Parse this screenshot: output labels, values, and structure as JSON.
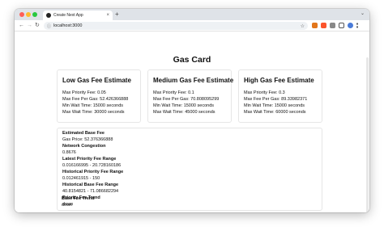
{
  "browser": {
    "tab_title": "Create Next App",
    "tab_close": "×",
    "new_tab": "+",
    "tab_menu": "⌄",
    "back": "←",
    "forward": "→",
    "reload": "↻",
    "url": "localhost:3000",
    "url_info": "ⓘ",
    "bookmark": "☆",
    "colors": {
      "close": "#ff5f57",
      "minimize": "#febc2e",
      "maximize": "#28c840",
      "tabbar": "#dfe3e8"
    },
    "extensions": [
      {
        "name": "fox-extension-icon",
        "color": "#e2761b"
      },
      {
        "name": "shield-extension-icon",
        "color": "#fb542b"
      },
      {
        "name": "puzzle-extension-icon",
        "color": "#666666"
      },
      {
        "name": "sidebar-icon",
        "color": "#555555"
      },
      {
        "name": "profile-icon",
        "color": "#4a7bd8"
      },
      {
        "name": "menu-icon",
        "color": "#555555"
      }
    ]
  },
  "page": {
    "title": "Gas Card",
    "cards": [
      {
        "title": "Low Gas Fee Estimate",
        "priority": "Max Priority Fee: 0.05",
        "fee_per_gas": "Max Fee Per Gas: 52.426366888",
        "min_wait": "Min Wait Time: 15000 seconds",
        "max_wait": "Max Wait Time: 30000 seconds"
      },
      {
        "title": "Medium Gas Fee Estimate",
        "priority": "Max Priority Fee: 0.1",
        "fee_per_gas": "Max Fee Per Gas: 70.808095299",
        "min_wait": "Min Wait Time: 15000 seconds",
        "max_wait": "Max Wait Time: 45000 seconds"
      },
      {
        "title": "High Gas Fee Estimate",
        "priority": "Max Priority Fee: 0.3",
        "fee_per_gas": "Max Fee Per Gas: 89.33982371",
        "min_wait": "Min Wait Time: 15000 seconds",
        "max_wait": "Max Wait Time: 60000 seconds"
      }
    ],
    "details": {
      "base_fee_label": "Estimated Base Fee",
      "gas_price": "Gas Price: 52.376366888",
      "congestion_label": "Network Congestion",
      "congestion_value": "0.8676",
      "priority_range_label": "Latest Priority Fee Range",
      "priority_range_value": "0.016166995 - 20.728160186",
      "hist_priority_label": "Historical Priority Fee Range",
      "hist_priority_value": "0.012461915 - 150",
      "hist_base_label": "Historical Base Fee Range",
      "hist_base_value": "40.8154821 - 71.086682294",
      "priority_trend_label": "Priority Fee Trend",
      "priority_trend_value": "down",
      "base_trend_label": "Base Fee Trend",
      "base_trend_value": "down"
    }
  }
}
